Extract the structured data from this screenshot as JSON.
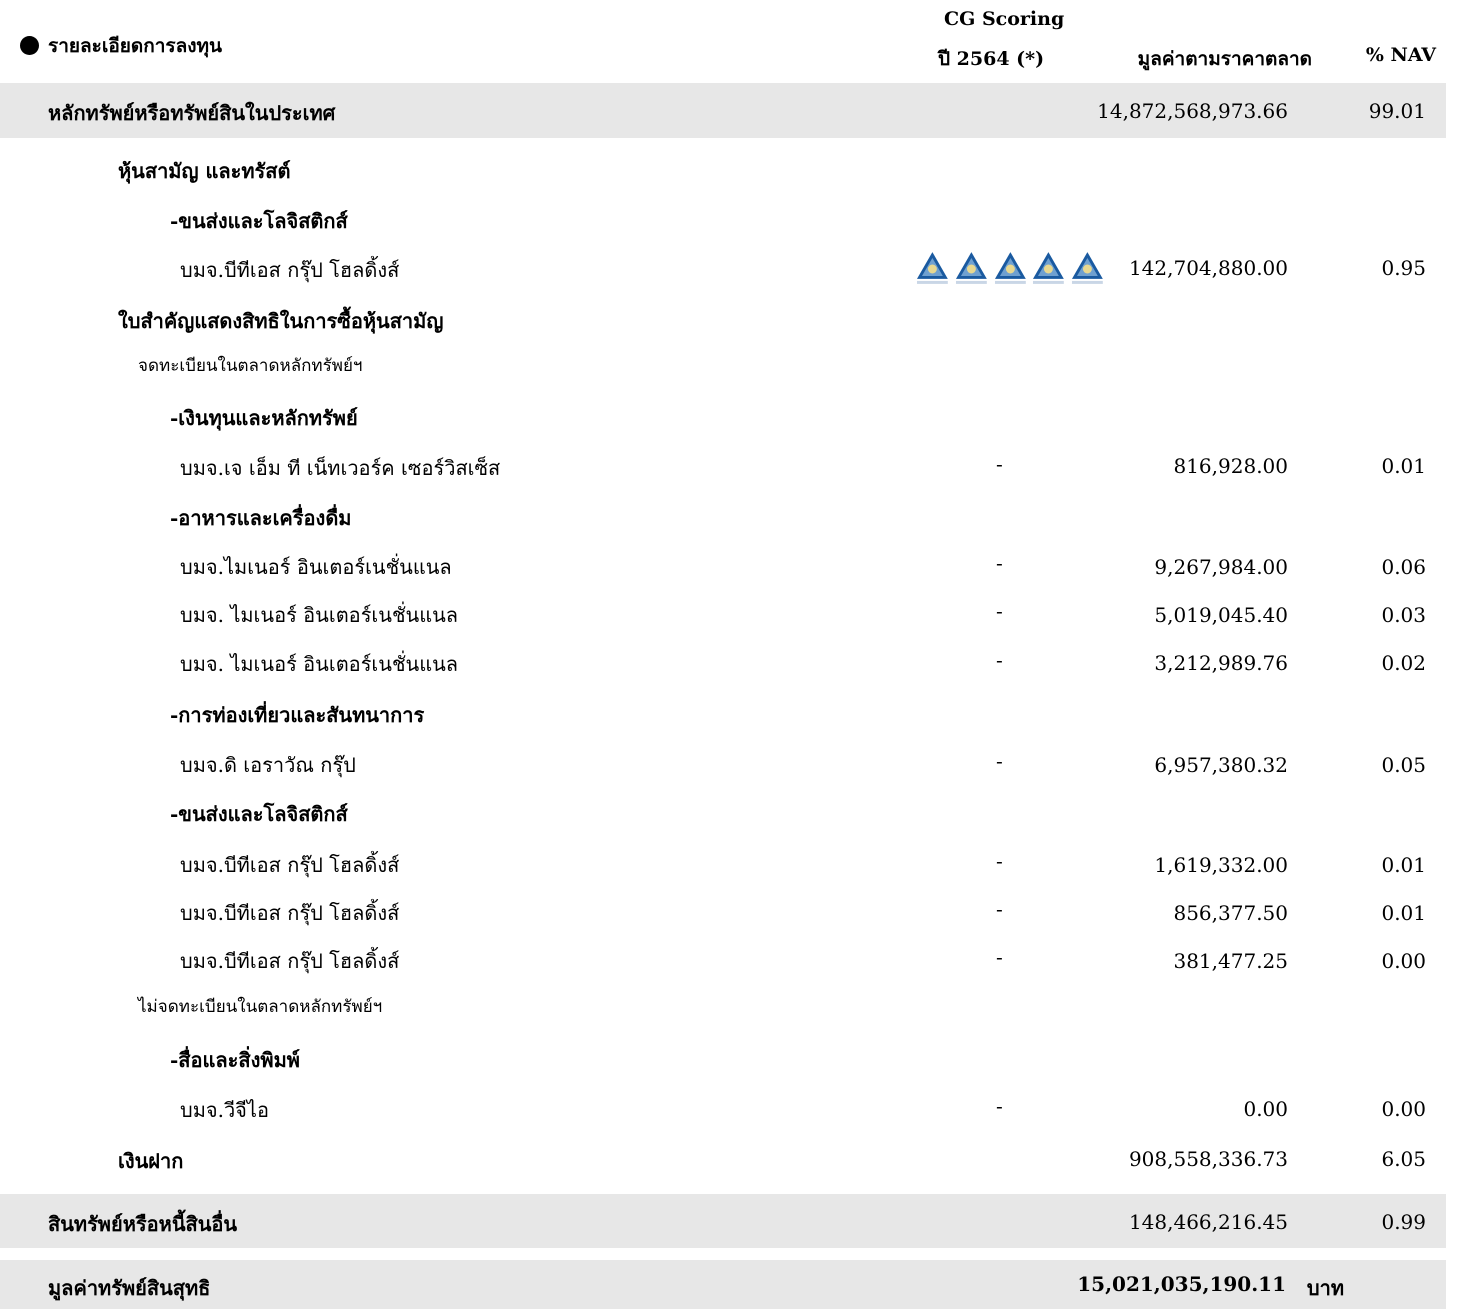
{
  "header": {
    "title": "รายละเอียดการลงทุน",
    "cg_line1": "CG Scoring",
    "cg_line2": "ปี 2564 (*)",
    "market_value": "มูลค่าตามราคาตลาด",
    "nav": "% NAV"
  },
  "rows": {
    "domestic": {
      "label": "หลักทรัพย์หรือทรัพย์สินในประเทศ",
      "value": "14,872,568,973.66",
      "nav": "99.01"
    },
    "common_trust": {
      "label": "หุ้นสามัญ และทรัสต์"
    },
    "transport1": {
      "label": "-ขนส่งและโลจิสติกส์"
    },
    "bts1": {
      "label": "บมจ.บีทีเอส กรุ๊ป โฮลดิ้งส์",
      "value": "142,704,880.00",
      "nav": "0.95"
    },
    "warrants": {
      "label": "ใบสำคัญแสดงสิทธิในการซื้อหุ้นสามัญ"
    },
    "listed": {
      "label": "จดทะเบียนในตลาดหลักทรัพย์ฯ"
    },
    "finance": {
      "label": "-เงินทุนและหลักทรัพย์"
    },
    "jmt": {
      "label": "บมจ.เจ เอ็ม ที เน็ทเวอร์ค เซอร์วิสเซ็ส",
      "cg": "-",
      "value": "816,928.00",
      "nav": "0.01"
    },
    "food": {
      "label": "-อาหารและเครื่องดื่ม"
    },
    "minor1": {
      "label": "บมจ.ไมเนอร์ อินเตอร์เนชั่นแนล",
      "cg": "-",
      "value": "9,267,984.00",
      "nav": "0.06"
    },
    "minor2": {
      "label": "บมจ. ไมเนอร์ อินเตอร์เนชั่นแนล",
      "cg": "-",
      "value": "5,019,045.40",
      "nav": "0.03"
    },
    "minor3": {
      "label": "บมจ. ไมเนอร์ อินเตอร์เนชั่นแนล",
      "cg": "-",
      "value": "3,212,989.76",
      "nav": "0.02"
    },
    "tourism": {
      "label": "-การท่องเที่ยวและสันทนาการ"
    },
    "erawan": {
      "label": "บมจ.ดิ เอราวัณ กรุ๊ป",
      "cg": "-",
      "value": "6,957,380.32",
      "nav": "0.05"
    },
    "transport2": {
      "label": "-ขนส่งและโลจิสติกส์"
    },
    "bts2": {
      "label": "บมจ.บีทีเอส กรุ๊ป โฮลดิ้งส์",
      "cg": "-",
      "value": "1,619,332.00",
      "nav": "0.01"
    },
    "bts3": {
      "label": "บมจ.บีทีเอส กรุ๊ป โฮลดิ้งส์",
      "cg": "-",
      "value": "856,377.50",
      "nav": "0.01"
    },
    "bts4": {
      "label": "บมจ.บีทีเอส กรุ๊ป โฮลดิ้งส์",
      "cg": "-",
      "value": "381,477.25",
      "nav": "0.00"
    },
    "unlisted": {
      "label": "ไม่จดทะเบียนในตลาดหลักทรัพย์ฯ"
    },
    "media": {
      "label": "-สื่อและสิ่งพิมพ์"
    },
    "vgi": {
      "label": "บมจ.วีจีไอ",
      "cg": "-",
      "value": "0.00",
      "nav": "0.00"
    },
    "deposit": {
      "label": "เงินฝาก",
      "value": "908,558,336.73",
      "nav": "6.05"
    },
    "other_assets": {
      "label": "สินทรัพย์หรือหนี้สินอื่น",
      "value": "148,466,216.45",
      "nav": "0.99"
    },
    "nav_total": {
      "label": "มูลค่าทรัพย์สินสุทธิ",
      "value": "15,021,035,190.11",
      "unit": "บาท"
    }
  },
  "cg_rating": {
    "icon": "cg-triangle-icon",
    "count": 5,
    "color": "#1a5aa0"
  }
}
